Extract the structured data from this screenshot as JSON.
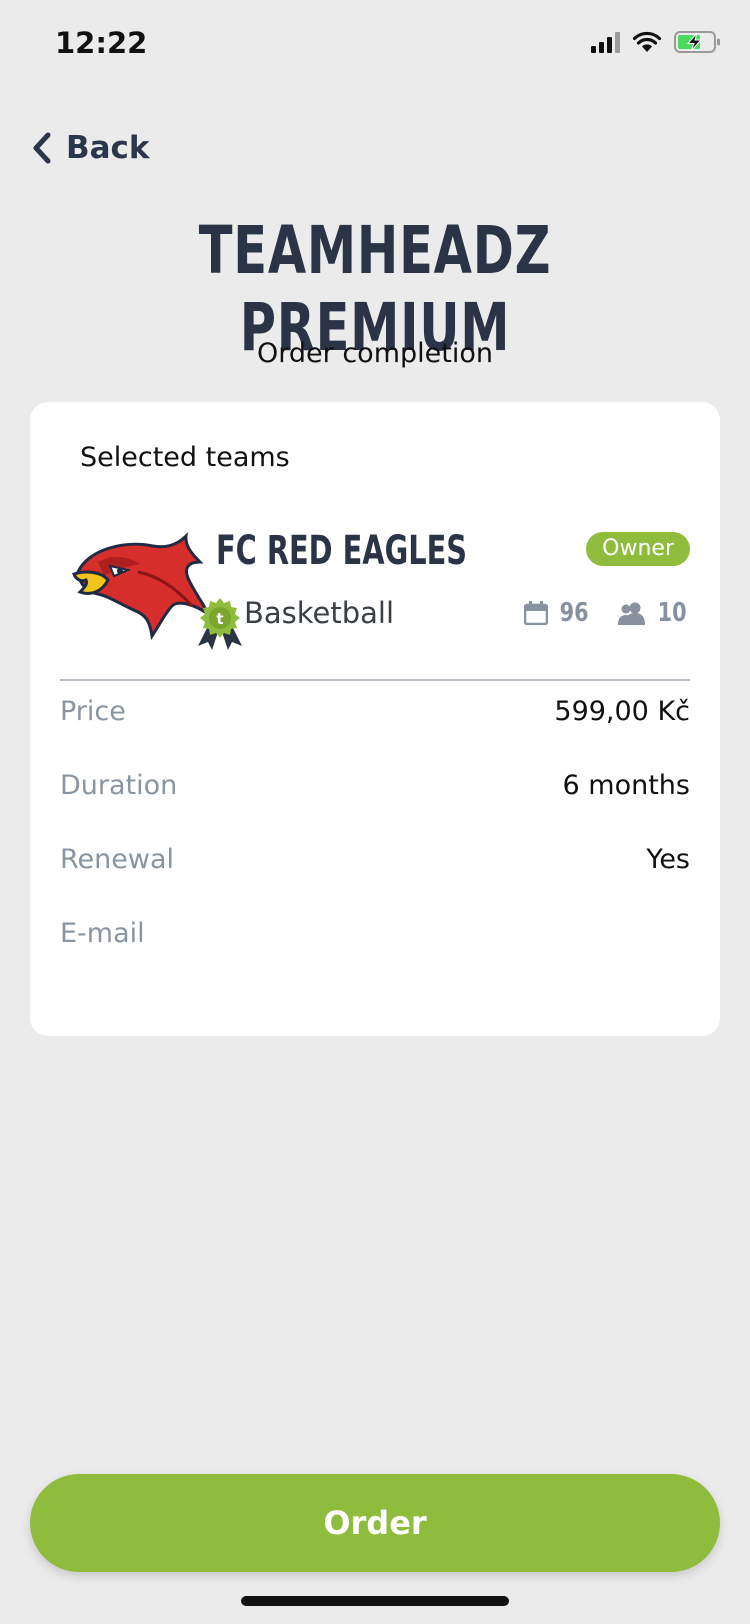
{
  "status_bar": {
    "time": "12:22"
  },
  "nav": {
    "back_label": "Back"
  },
  "header": {
    "title": "TEAMHEADZ PREMIUM",
    "subtitle": "Order completion"
  },
  "card": {
    "heading": "Selected teams",
    "team": {
      "name": "FC RED EAGLES",
      "sport": "Basketball",
      "role_badge": "Owner",
      "events_count": "96",
      "members_count": "10",
      "logo_icon": "eagle-logo-icon",
      "premium_icon": "premium-badge-icon"
    },
    "details": [
      {
        "label": "Price",
        "value": "599,00 Kč"
      },
      {
        "label": "Duration",
        "value": "6 months"
      },
      {
        "label": "Renewal",
        "value": "Yes"
      },
      {
        "label": "E-mail",
        "value": ""
      }
    ]
  },
  "actions": {
    "order_label": "Order"
  },
  "colors": {
    "accent": "#8fbc3d",
    "title": "#2b3447",
    "muted": "#8a95a3",
    "background": "#ebebeb"
  }
}
